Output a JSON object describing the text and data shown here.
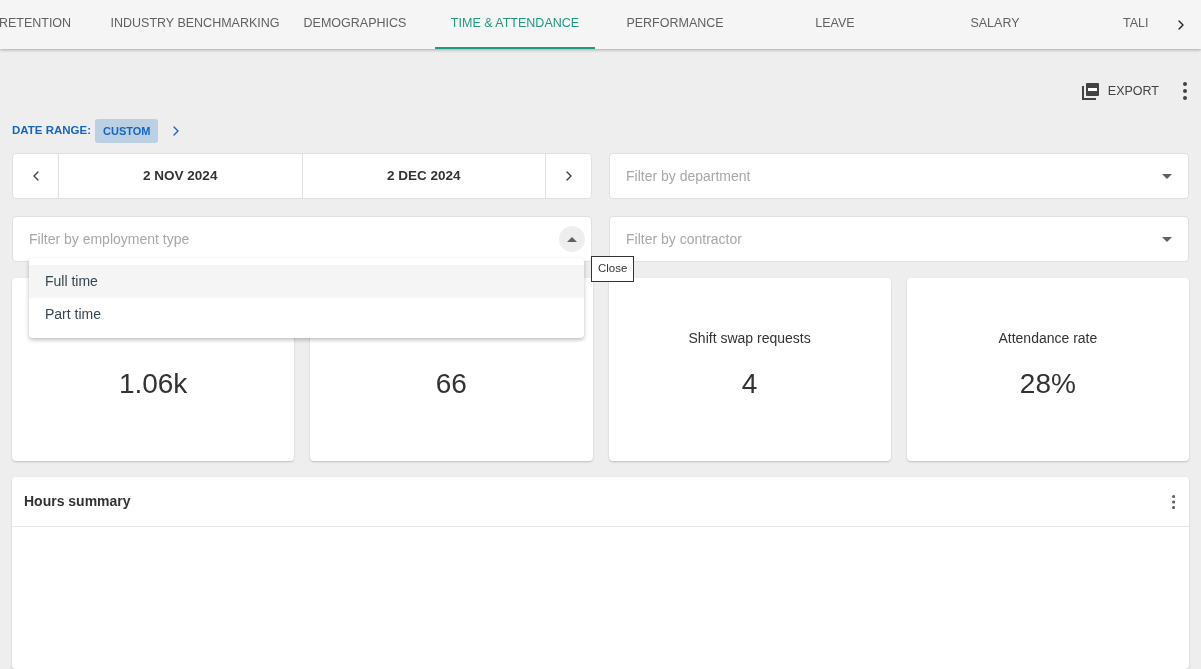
{
  "tabs": [
    {
      "label": "RETENTION",
      "selected": false
    },
    {
      "label": "INDUSTRY BENCHMARKING",
      "selected": false
    },
    {
      "label": "DEMOGRAPHICS",
      "selected": false
    },
    {
      "label": "TIME & ATTENDANCE",
      "selected": true
    },
    {
      "label": "PERFORMANCE",
      "selected": false
    },
    {
      "label": "LEAVE",
      "selected": false
    },
    {
      "label": "SALARY",
      "selected": false
    },
    {
      "label": "TALI",
      "selected": false
    }
  ],
  "toolbar": {
    "export_label": "EXPORT"
  },
  "date_range": {
    "label": "DATE RANGE:",
    "value": "CUSTOM",
    "start": "2 NOV 2024",
    "end": "2 DEC 2024"
  },
  "filters": {
    "department": {
      "placeholder": "Filter by department"
    },
    "employment_type": {
      "placeholder": "Filter by employment type",
      "expanded": true,
      "options": [
        {
          "label": "Full time",
          "selected": true
        },
        {
          "label": "Part time",
          "selected": false
        }
      ]
    },
    "contractor": {
      "placeholder": "Filter by contractor"
    }
  },
  "tooltip": "Close",
  "stats": [
    {
      "value": "1.06k"
    },
    {
      "value": "66"
    },
    {
      "label": "Shift swap requests",
      "value": "4"
    },
    {
      "label": "Attendance rate",
      "value": "28%"
    }
  ],
  "hours_summary": {
    "title": "Hours summary"
  }
}
